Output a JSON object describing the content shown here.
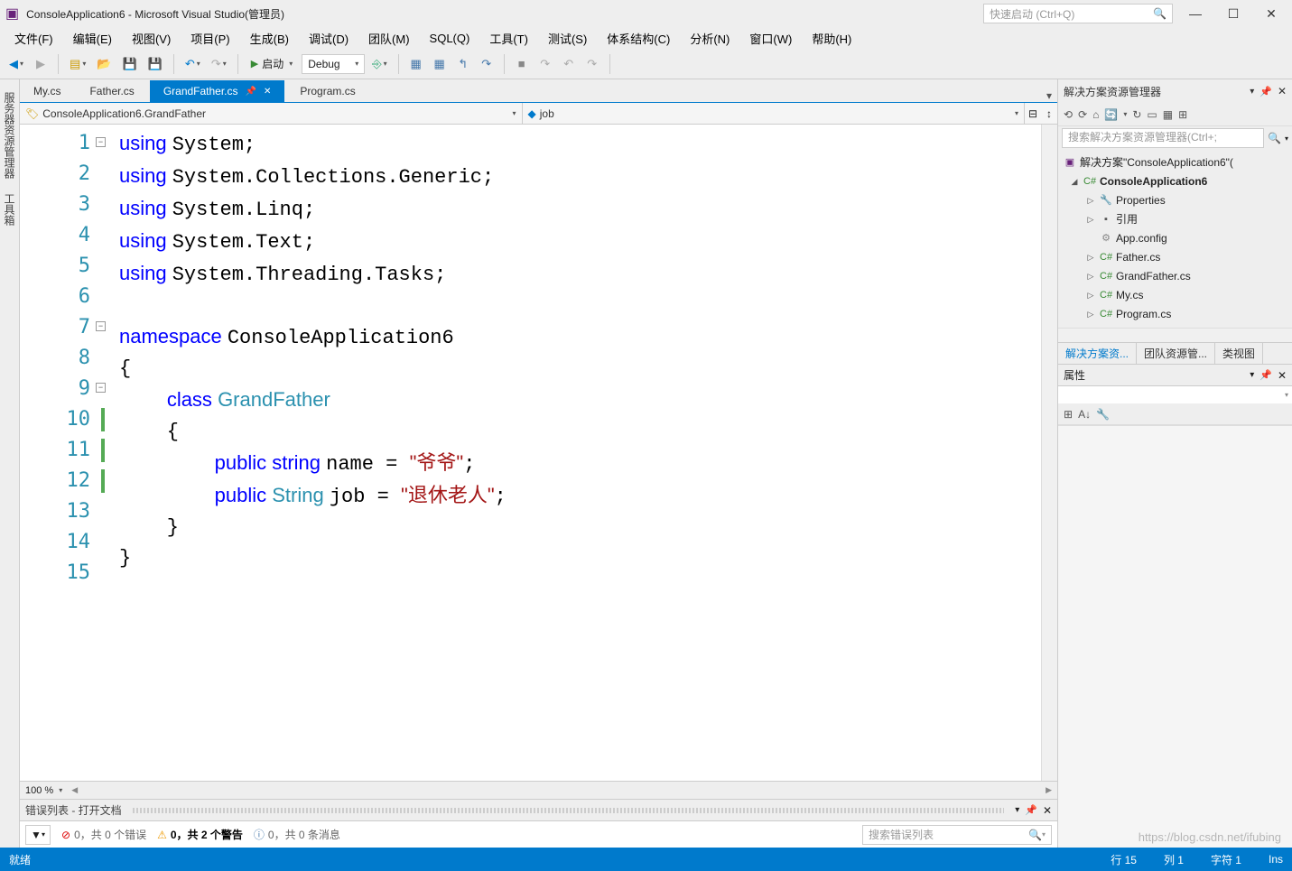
{
  "title": "ConsoleApplication6 - Microsoft Visual Studio(管理员)",
  "quicklaunch_placeholder": "快速启动 (Ctrl+Q)",
  "menu": [
    "文件(F)",
    "编辑(E)",
    "视图(V)",
    "项目(P)",
    "生成(B)",
    "调试(D)",
    "团队(M)",
    "SQL(Q)",
    "工具(T)",
    "测试(S)",
    "体系结构(C)",
    "分析(N)",
    "窗口(W)",
    "帮助(H)"
  ],
  "toolbar": {
    "start_label": "启动",
    "config": "Debug"
  },
  "left_tabs": [
    "服务器资源管理器",
    "工具箱"
  ],
  "doc_tabs": [
    {
      "label": "My.cs",
      "active": false
    },
    {
      "label": "Father.cs",
      "active": false
    },
    {
      "label": "GrandFather.cs",
      "active": true
    },
    {
      "label": "Program.cs",
      "active": false
    }
  ],
  "nav": {
    "left": "ConsoleApplication6.GrandFather",
    "right": "job"
  },
  "code_lines": [
    [
      {
        "t": "using ",
        "c": "kw"
      },
      {
        "t": "System;",
        "c": ""
      }
    ],
    [
      {
        "t": "using ",
        "c": "kw"
      },
      {
        "t": "System.Collections.Generic;",
        "c": ""
      }
    ],
    [
      {
        "t": "using ",
        "c": "kw"
      },
      {
        "t": "System.Linq;",
        "c": ""
      }
    ],
    [
      {
        "t": "using ",
        "c": "kw"
      },
      {
        "t": "System.Text;",
        "c": ""
      }
    ],
    [
      {
        "t": "using ",
        "c": "kw"
      },
      {
        "t": "System.Threading.Tasks;",
        "c": ""
      }
    ],
    [
      {
        "t": "",
        "c": ""
      }
    ],
    [
      {
        "t": "namespace ",
        "c": "kw"
      },
      {
        "t": "ConsoleApplication6",
        "c": ""
      }
    ],
    [
      {
        "t": "{",
        "c": ""
      }
    ],
    [
      {
        "t": "    ",
        "c": ""
      },
      {
        "t": "class ",
        "c": "kw"
      },
      {
        "t": "GrandFather",
        "c": "type"
      }
    ],
    [
      {
        "t": "    {",
        "c": ""
      }
    ],
    [
      {
        "t": "        ",
        "c": ""
      },
      {
        "t": "public ",
        "c": "kw"
      },
      {
        "t": "string ",
        "c": "kw"
      },
      {
        "t": "name = ",
        "c": ""
      },
      {
        "t": "\"爷爷\"",
        "c": "str"
      },
      {
        "t": ";",
        "c": ""
      }
    ],
    [
      {
        "t": "        ",
        "c": ""
      },
      {
        "t": "public ",
        "c": "kw"
      },
      {
        "t": "String ",
        "c": "type"
      },
      {
        "t": "job = ",
        "c": ""
      },
      {
        "t": "\"退休老人\"",
        "c": "str"
      },
      {
        "t": ";",
        "c": ""
      }
    ],
    [
      {
        "t": "    }",
        "c": ""
      }
    ],
    [
      {
        "t": "}",
        "c": ""
      }
    ],
    [
      {
        "t": "",
        "c": ""
      }
    ]
  ],
  "collapse_lines": [
    1,
    7,
    9
  ],
  "green_margin_lines": [
    10,
    11,
    12
  ],
  "zoom": "100 %",
  "error_panel": {
    "title": "错误列表 - 打开文档",
    "errors": "0，共 0 个错误",
    "warnings": "0，共 2 个警告",
    "messages": "0，共 0 条消息",
    "search_placeholder": "搜索错误列表"
  },
  "solution": {
    "panel_title": "解决方案资源管理器",
    "search_placeholder": "搜索解决方案资源管理器(Ctrl+;",
    "root": "解决方案\"ConsoleApplication6\"(",
    "project": "ConsoleApplication6",
    "nodes": [
      "Properties",
      "引用",
      "App.config",
      "Father.cs",
      "GrandFather.cs",
      "My.cs",
      "Program.cs"
    ]
  },
  "right_tabs": [
    "解决方案资...",
    "团队资源管...",
    "类视图"
  ],
  "properties_title": "属性",
  "status": {
    "ready": "就绪",
    "line": "行 15",
    "col": "列 1",
    "char": "字符 1",
    "ins": "Ins"
  },
  "watermark": "https://blog.csdn.net/ifubing"
}
